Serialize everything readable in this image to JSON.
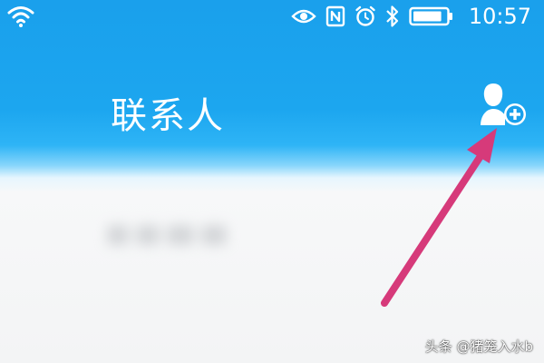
{
  "status_bar": {
    "time": "10:57",
    "icons": [
      "wifi-icon",
      "eye-icon",
      "nfc-icon",
      "alarm-icon",
      "bluetooth-icon",
      "battery-icon"
    ],
    "battery_level": 0.85
  },
  "header": {
    "title": "联系人",
    "add_contact_icon": "add-contact-icon"
  },
  "annotation": {
    "arrow_color": "#d63a7a",
    "points_to": "add-contact-button"
  },
  "watermark": {
    "text": "头条 @猪笼入水b"
  },
  "colors": {
    "header_blue": "#1ca6ef",
    "text_white": "#ffffff",
    "background": "#f3f4f5"
  }
}
